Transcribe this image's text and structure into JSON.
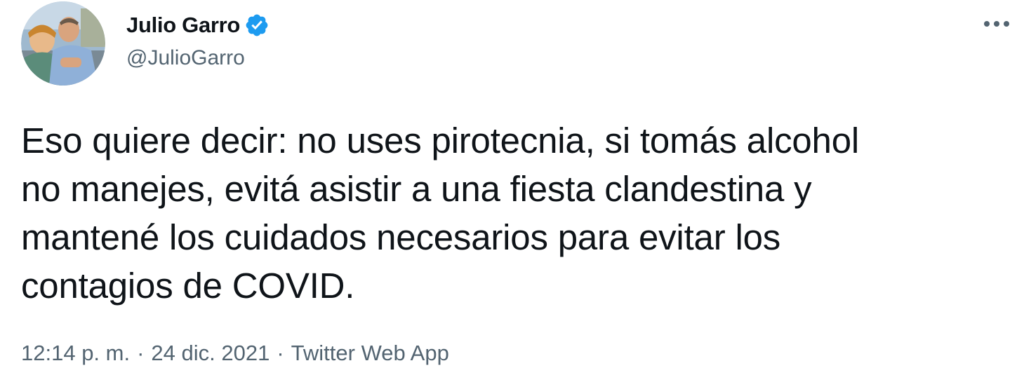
{
  "author": {
    "display_name": "Julio Garro",
    "handle": "@JulioGarro",
    "verified_icon": "verified-badge-icon",
    "avatar": "profile-photo"
  },
  "menu": {
    "more_icon": "more-options-icon"
  },
  "tweet": {
    "text": "Eso quiere decir: no uses pirotecnia, si tomás alcohol\nno manejes, evitá asistir a una fiesta clandestina y\nmantené los cuidados necesarios para evitar los\ncontagios de COVID."
  },
  "meta": {
    "time": "12:14 p. m.",
    "separator": "·",
    "date": "24 dic. 2021",
    "source": "Twitter Web App"
  },
  "colors": {
    "text_primary": "#0f1419",
    "text_secondary": "#536471",
    "verified_blue": "#1d9bf0"
  }
}
